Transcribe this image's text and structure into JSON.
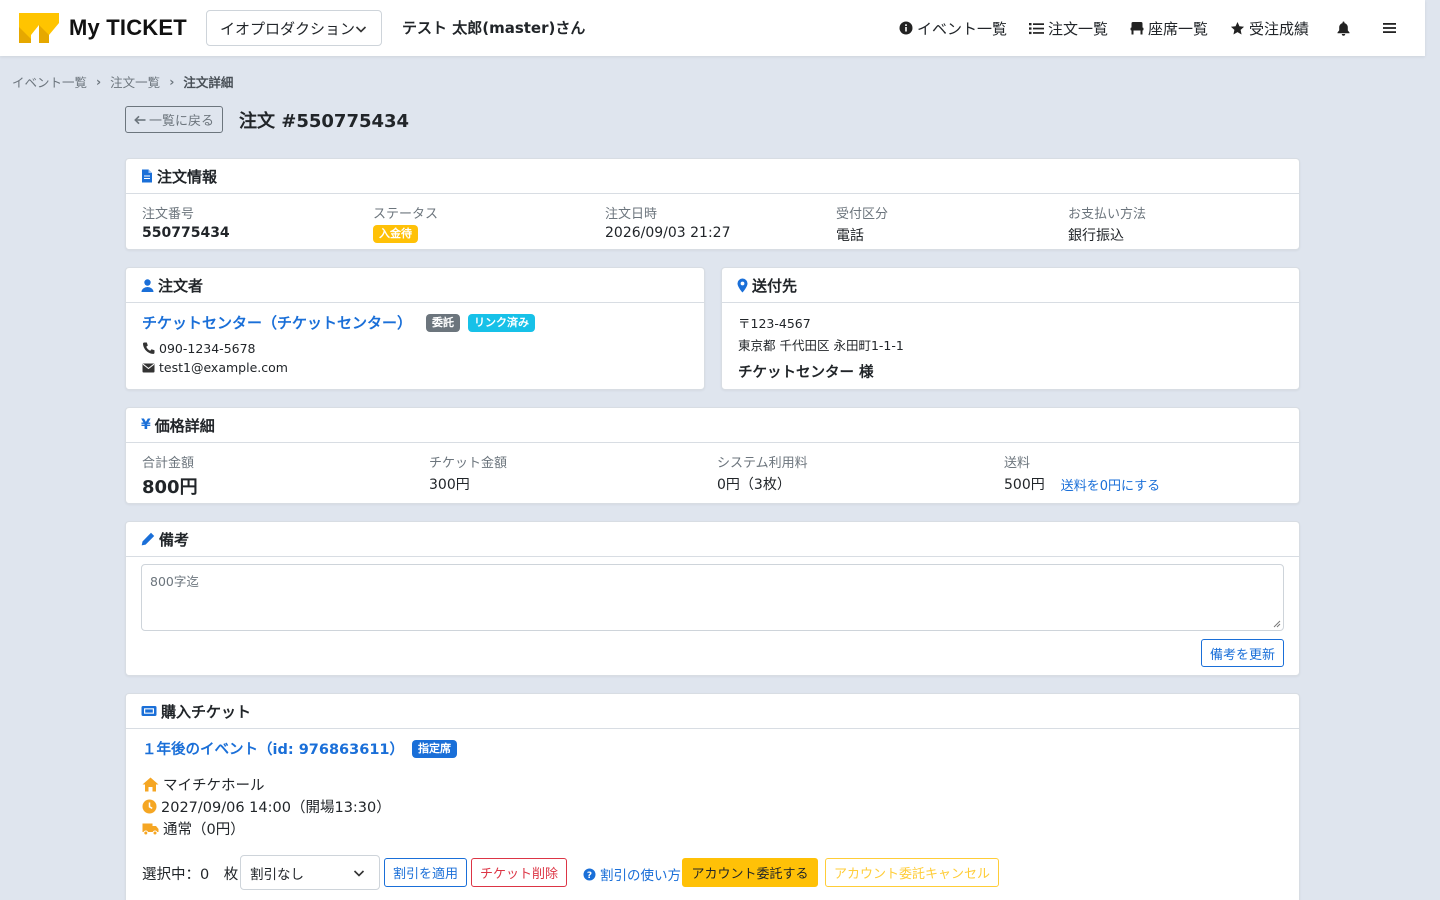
{
  "app": {
    "name": "My TICKET"
  },
  "header": {
    "org_select": "イオプロダクション",
    "user_name": "テスト 太郎(master)さん",
    "nav": {
      "events": "イベント一覧",
      "orders": "注文一覧",
      "seats": "座席一覧",
      "results": "受注成績"
    }
  },
  "breadcrumb": [
    "イベント一覧",
    "注文一覧",
    "注文詳細"
  ],
  "page": {
    "back_label": "一覧に戻る",
    "title": "注文 #550775434"
  },
  "order_info": {
    "header": "注文情報",
    "fields": [
      {
        "label": "注文番号",
        "value": "550775434"
      },
      {
        "label": "ステータス",
        "value": "入金待"
      },
      {
        "label": "注文日時",
        "value": "2026/09/03 21:27"
      },
      {
        "label": "受付区分",
        "value": "電話"
      },
      {
        "label": "お支払い方法",
        "value": "銀行振込"
      }
    ],
    "status_color": "#ffc107"
  },
  "customer": {
    "header": "注文者",
    "name": "チケットセンター（チケットセンター）",
    "badge_consign": "委託",
    "badge_linked": "リンク済み",
    "phone": "090-1234-5678",
    "email": "test1@example.com"
  },
  "shipping": {
    "header": "送付先",
    "postal": "〒123-4567",
    "address": "東京都 千代田区 永田町1-1-1",
    "recipient": "チケットセンター 様"
  },
  "price": {
    "header": "価格詳細",
    "total_label": "合計金額",
    "total_value": "800円",
    "ticket_label": "チケット金額",
    "ticket_value": "300円",
    "system_label": "システム利用料",
    "system_value": "0円（3枚）",
    "shipping_label": "送料",
    "shipping_value": "500円",
    "shipping_zero_link": "送料を0円にする"
  },
  "remarks": {
    "header": "備考",
    "placeholder": "800字迄",
    "update_button": "備考を更新"
  },
  "tickets": {
    "header": "購入チケット",
    "event_title": "１年後のイベント（id: 976863611）",
    "seat_badge": "指定席",
    "venue": "マイチケホール",
    "datetime": "2027/09/06 14:00（開場13:30）",
    "delivery": "通常（0円）",
    "selected_label": "選択中：0　枚",
    "discount_select": "割引なし",
    "apply_discount": "割引を適用",
    "delete_ticket": "チケット削除",
    "discount_help": "割引の使い方",
    "consign_account": "アカウント委託する",
    "cancel_consign": "アカウント委託キャンセル"
  },
  "colors": {
    "brand_yellow": "#ffc107",
    "link_blue": "#1a6fd8",
    "badge_gray": "#6c757d",
    "badge_cyan": "#17c1e8",
    "danger": "#dc3545",
    "icon_orange": "#f5a623"
  }
}
